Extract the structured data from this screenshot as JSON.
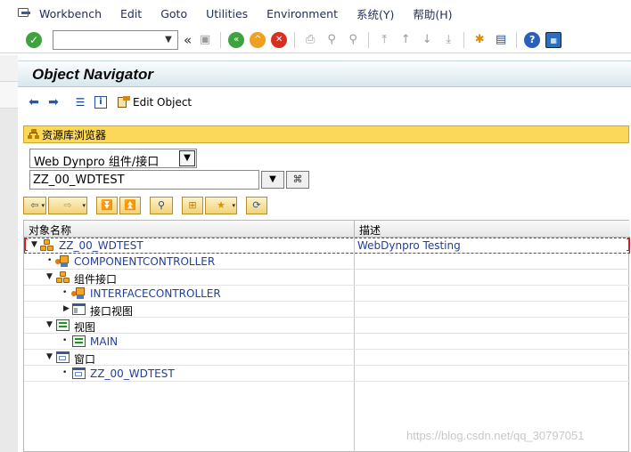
{
  "menubar": {
    "items": [
      "Workbench",
      "Edit",
      "Goto",
      "Utilities",
      "Environment",
      "系统(Y)",
      "帮助(H)"
    ]
  },
  "toolbar": {
    "command_value": "",
    "double_arrow": "«"
  },
  "title": "Object Navigator",
  "apptoolbar": {
    "edit_object_label": "Edit Object"
  },
  "repository": {
    "label": "资源库浏览器",
    "object_type": "Web Dynpro 组件/接口",
    "object_name": "ZZ_00_WDTEST"
  },
  "tree": {
    "col_name": "对象名称",
    "col_desc": "描述",
    "rows": [
      {
        "label": "ZZ_00_WDTEST",
        "desc": "WebDynpro Testing",
        "icon": "component-icon",
        "toggle": "▼"
      },
      {
        "label": "COMPONENTCONTROLLER",
        "desc": "",
        "icon": "controller-icon",
        "toggle": "•"
      },
      {
        "label": "组件接口",
        "desc": "",
        "icon": "component-interface-icon",
        "toggle": "▼"
      },
      {
        "label": "INTERFACECONTROLLER",
        "desc": "",
        "icon": "controller-icon",
        "toggle": "•"
      },
      {
        "label": "接口视图",
        "desc": "",
        "icon": "interface-view-icon",
        "toggle": "▶"
      },
      {
        "label": "视图",
        "desc": "",
        "icon": "view-folder-icon",
        "toggle": "▼"
      },
      {
        "label": "MAIN",
        "desc": "",
        "icon": "view-icon",
        "toggle": "•"
      },
      {
        "label": "窗口",
        "desc": "",
        "icon": "window-folder-icon",
        "toggle": "▼"
      },
      {
        "label": "ZZ_00_WDTEST",
        "desc": "",
        "icon": "window-icon",
        "toggle": "•"
      }
    ]
  },
  "watermark": "https://blog.csdn.net/qq_30797051"
}
